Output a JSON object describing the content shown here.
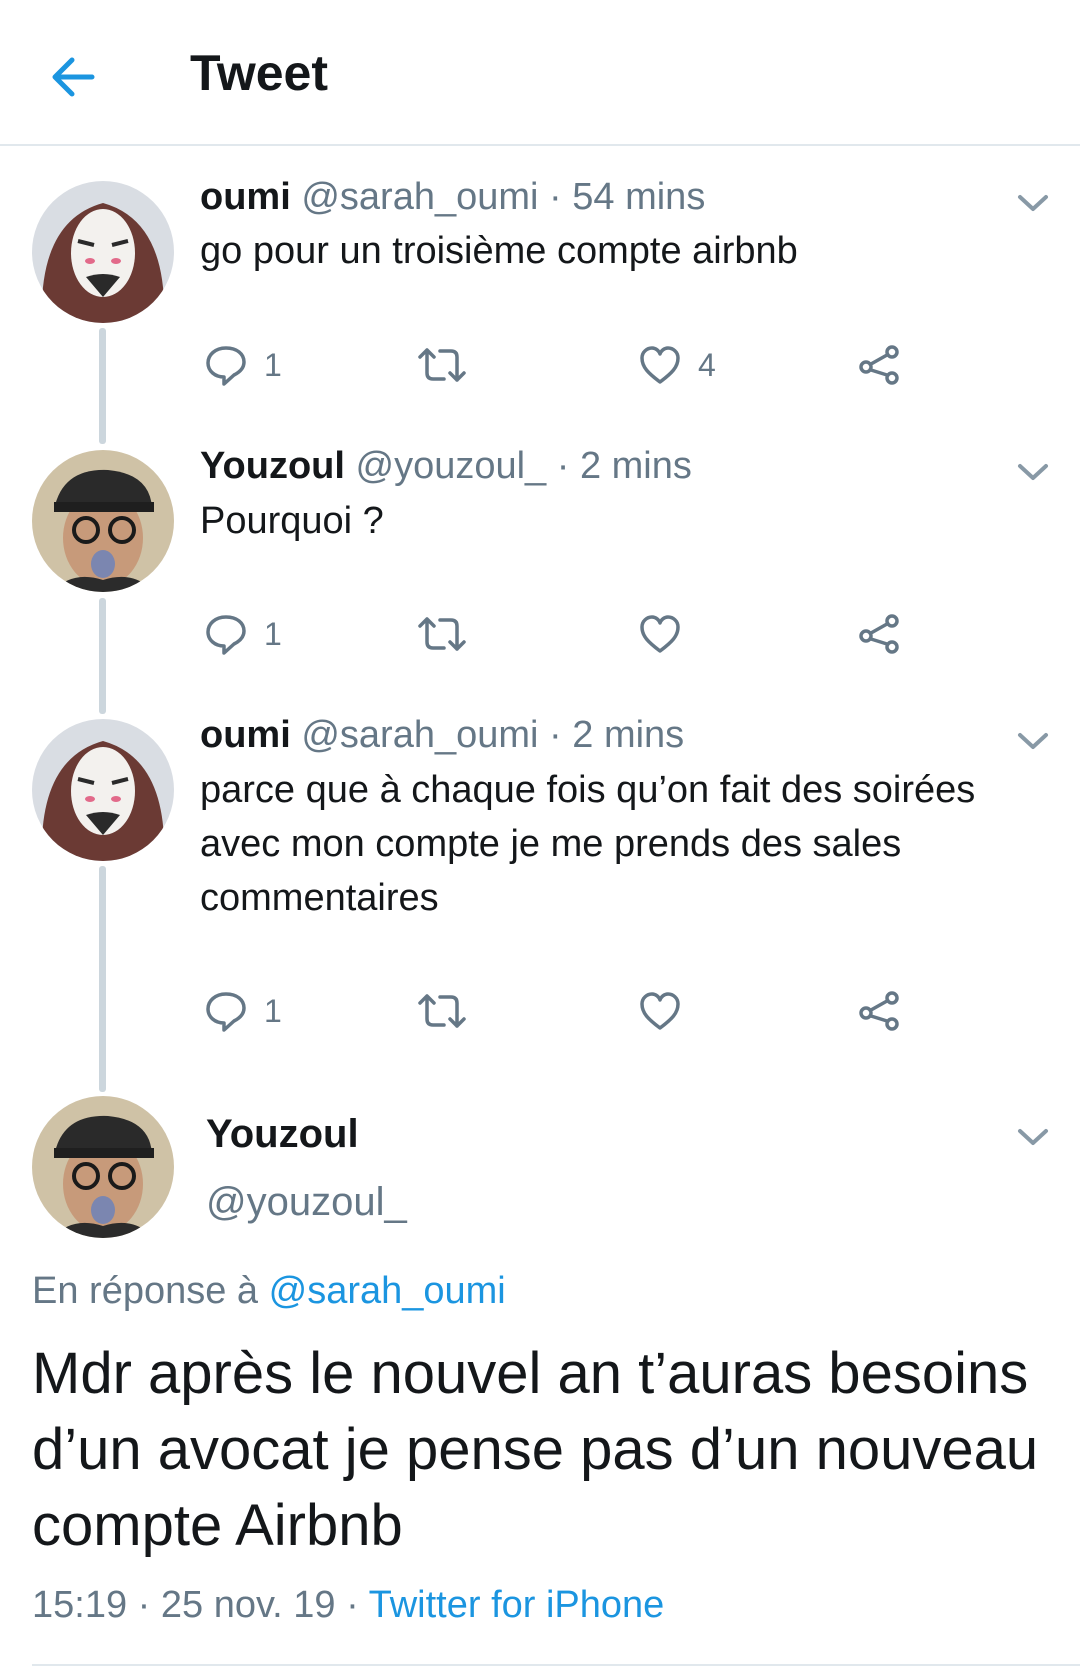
{
  "header": {
    "title": "Tweet",
    "back_icon": "arrow-left-icon"
  },
  "colors": {
    "accent": "#1b95e0",
    "secondary_text": "#657786",
    "thread_line": "#ccd6dd"
  },
  "thread": [
    {
      "name": "oumi",
      "handle": "@sarah_oumi",
      "time": "· 54 mins",
      "text": "go pour un troisième compte airbnb",
      "replies": "1",
      "likes": "4"
    },
    {
      "name": "Youzoul",
      "handle": "@youzoul_",
      "time": "· 2 mins",
      "text": "Pourquoi ?",
      "replies": "1",
      "likes": ""
    },
    {
      "name": "oumi",
      "handle": "@sarah_oumi",
      "time": "· 2 mins",
      "text": "parce que à chaque fois qu’on fait des soirées avec mon compte je me prends des sales commentaires",
      "replies": "1",
      "likes": ""
    }
  ],
  "main_tweet": {
    "name": "Youzoul",
    "handle": "@youzoul_",
    "reply_prefix": "En réponse à",
    "reply_handle": "@sarah_oumi",
    "text": "Mdr après le nouvel an t’auras besoins d’un avocat je pense pas d’un nouveau compte Airbnb",
    "time": "15:19 · 25 nov. 19 ·",
    "source": "Twitter for iPhone"
  }
}
